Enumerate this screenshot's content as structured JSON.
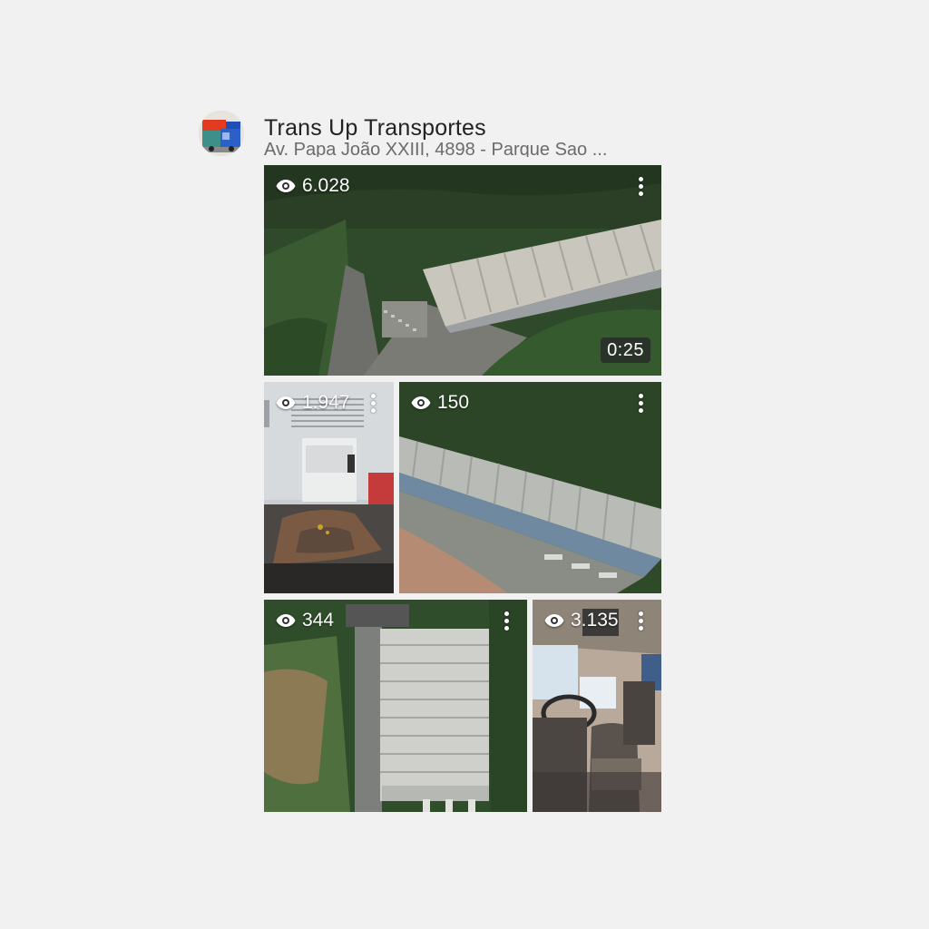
{
  "business": {
    "name": "Trans Up Transportes",
    "address": "Av. Papa João XXIII, 4898 - Parque Sao ..."
  },
  "icons": {
    "views": "eye-icon",
    "menu": "more-vertical-icon"
  },
  "videos": [
    {
      "views": "6.028",
      "duration": "0:25",
      "subject": "aerial warehouse with forest"
    },
    {
      "views": "1.947",
      "subject": "truck fifth wheel coupling"
    },
    {
      "views": "150",
      "subject": "aerial warehouse roof"
    },
    {
      "views": "344",
      "subject": "aerial top-down warehouse"
    },
    {
      "views": "3.135",
      "subject": "truck cab interior"
    }
  ]
}
